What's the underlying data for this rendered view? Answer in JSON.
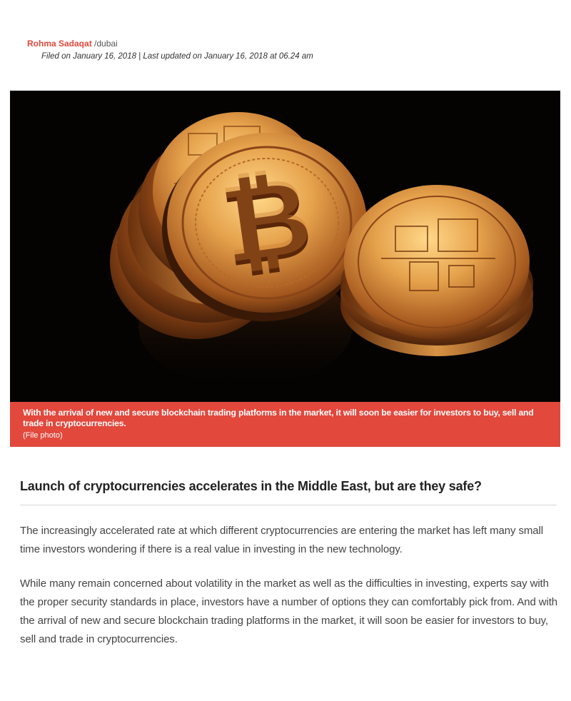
{
  "article": {
    "author": "Rohma Sadaqat",
    "location": "/dubai",
    "filed": "Filed on January 16, 2018 | Last updated on January 16, 2018 at 06.24 am",
    "image": {
      "alt": "Gold bitcoin coins on black reflective surface",
      "caption": "With the arrival of new and secure blockchain trading platforms in the market, it will soon be easier for investors to buy, sell and trade in cryptocurrencies.",
      "credit": "(File photo)"
    },
    "headline": "Launch of cryptocurrencies accelerates in the Middle East, but are they safe?",
    "paragraphs": [
      "The increasingly accelerated rate at which different cryptocurrencies are entering the market has left many small time investors wondering if there is a real value in investing in the new technology.",
      "While many remain concerned about volatility in the market as well as the difficulties in investing, experts say with the proper security standards in place, investors have a number of options they can comfortably pick from. And with the arrival of new and secure blockchain trading platforms in the market, it will soon be easier for investors to buy, sell and trade in cryptocurrencies."
    ]
  },
  "colors": {
    "accent": "#e2483c",
    "gold": "#d9913a",
    "background": "#050302"
  }
}
